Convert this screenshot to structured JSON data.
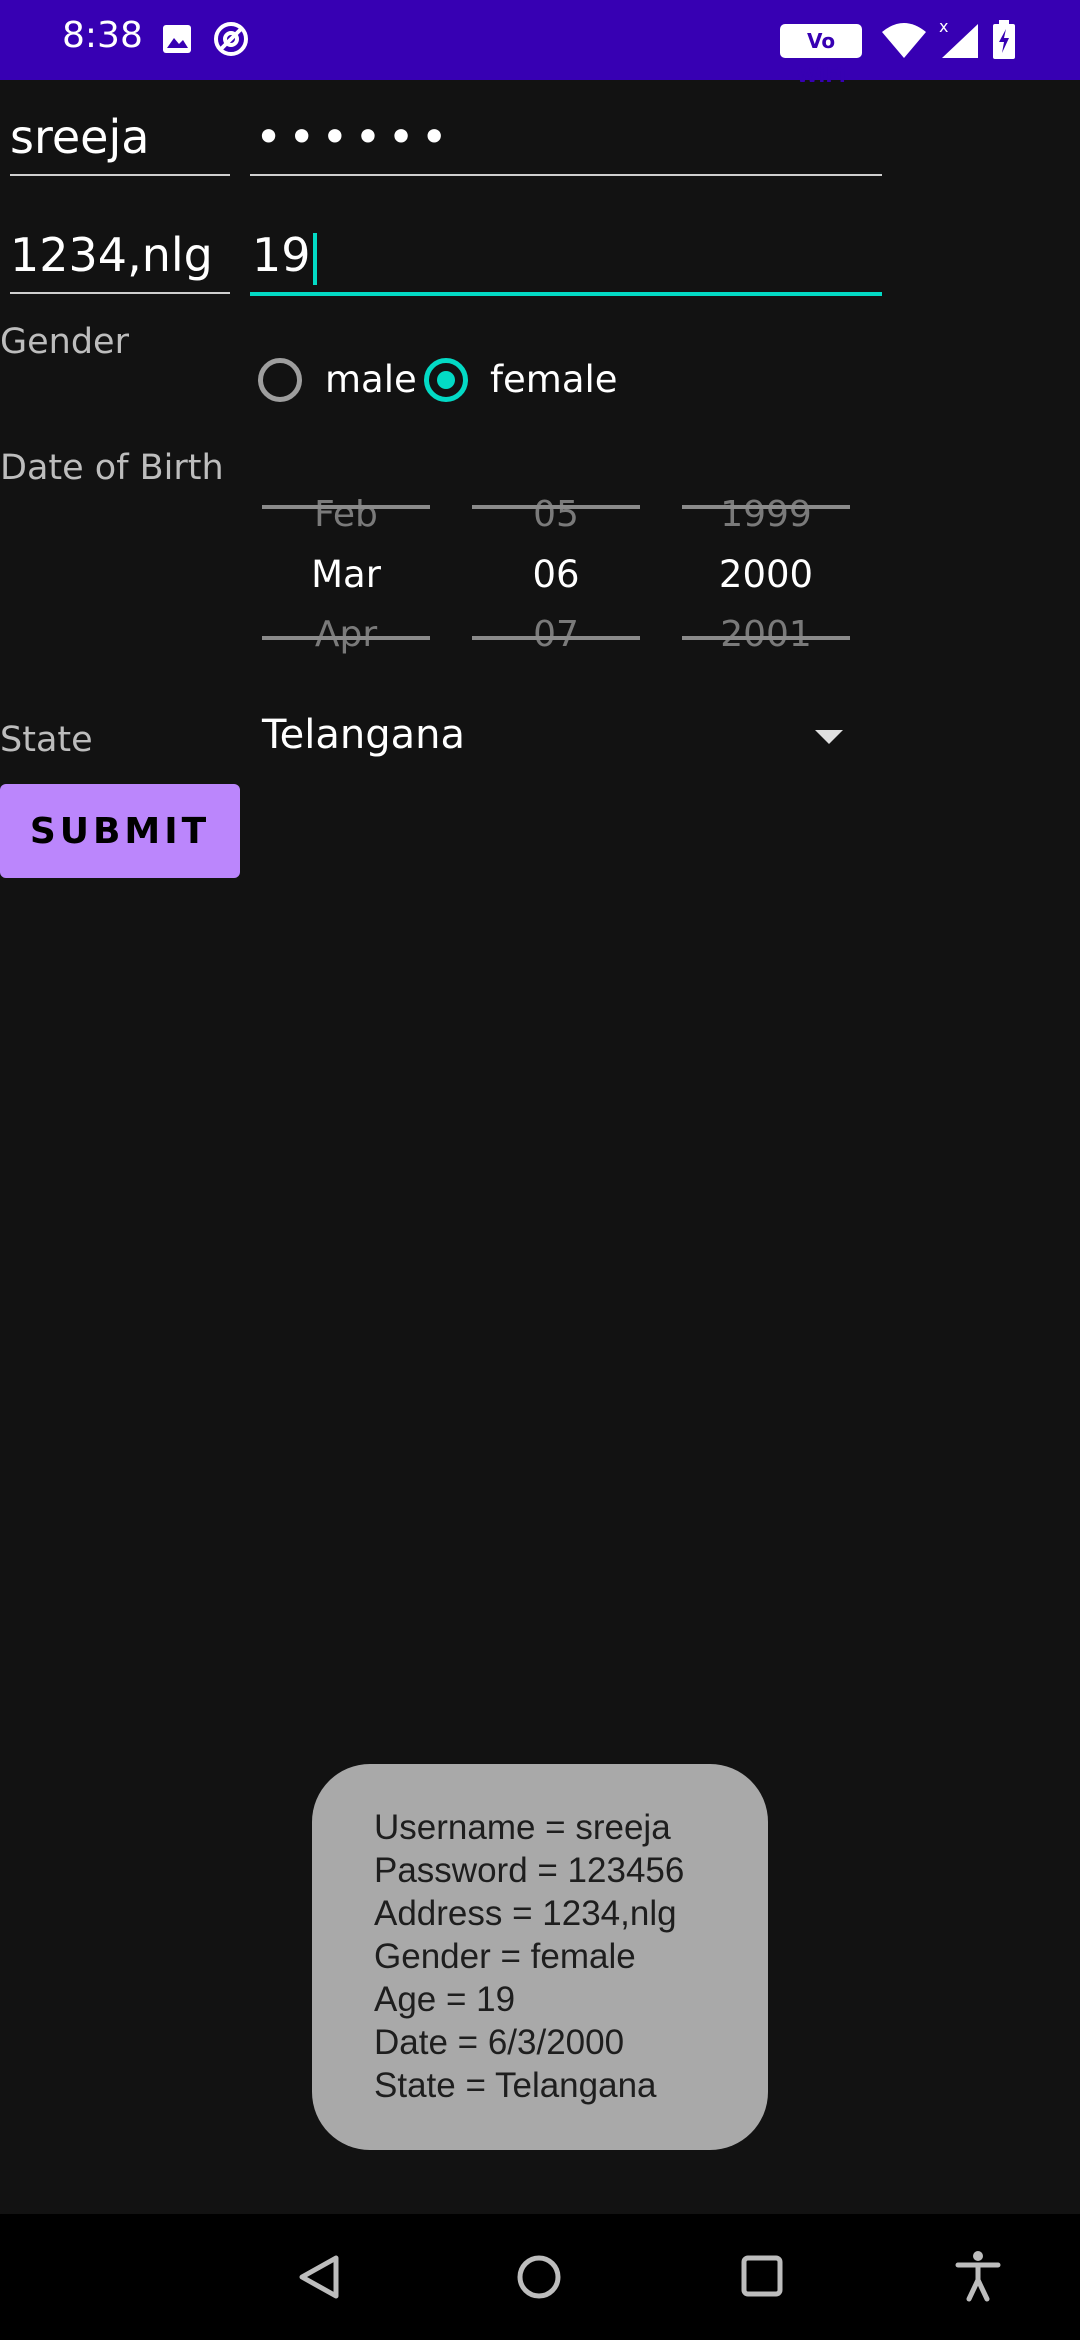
{
  "status_bar": {
    "time": "8:38",
    "vowifi_label": "Vo WiFi",
    "icons": [
      "gallery-icon",
      "sync-icon",
      "wifi-icon",
      "signal-icon",
      "battery-icon"
    ]
  },
  "form": {
    "username": "sreeja",
    "password_mask": "••••••",
    "address": "1234,nlg",
    "age": "19",
    "gender_label": "Gender",
    "gender_options": [
      "male",
      "female"
    ],
    "gender_selected": "female",
    "dob_label": "Date of Birth",
    "date_picker": {
      "month": {
        "prev": "Feb",
        "current": "Mar",
        "next": "Apr"
      },
      "day": {
        "prev": "05",
        "current": "06",
        "next": "07"
      },
      "year": {
        "prev": "1999",
        "current": "2000",
        "next": "2001"
      }
    },
    "state_label": "State",
    "state_value": "Telangana",
    "submit_label": "SUBMIT"
  },
  "toast": {
    "lines": [
      "Username = sreeja",
      "Password = 123456",
      "Address = 1234,nlg",
      "Gender = female",
      "Age = 19",
      "Date = 6/3/2000",
      "State = Telangana"
    ]
  },
  "colors": {
    "status_bar": "#3700B3",
    "background": "#121212",
    "accent": "#03DAC5",
    "button": "#BB86FC",
    "toast": "#A9A9A9"
  },
  "nav_bar": {
    "buttons": [
      "back-icon",
      "home-icon",
      "recents-icon",
      "accessibility-icon"
    ]
  }
}
